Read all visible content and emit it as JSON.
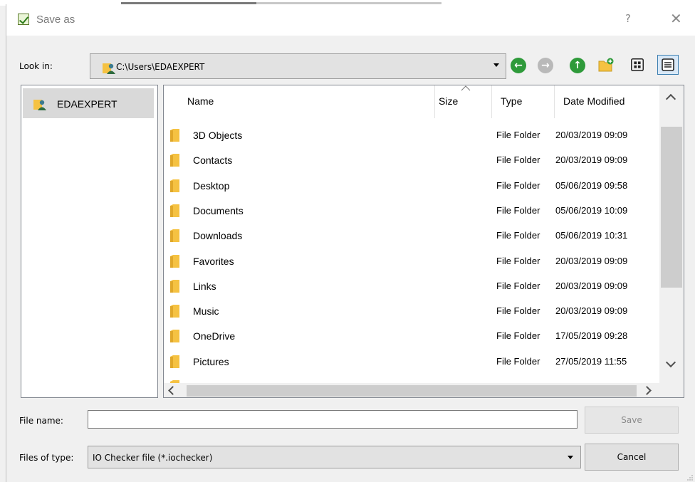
{
  "window": {
    "title": "Save as",
    "help_glyph": "?",
    "close_glyph": "✕"
  },
  "look_in": {
    "label": "Look in:",
    "path": "C:\\Users\\EDAEXPERT"
  },
  "toolbar": {
    "back_icon": "back-arrow-icon",
    "forward_icon": "forward-arrow-icon",
    "up_icon": "up-arrow-icon",
    "new_folder_icon": "new-folder-icon",
    "list_view_icon": "list-view-icon",
    "detail_view_icon": "detail-view-icon"
  },
  "sidebar": {
    "items": [
      {
        "label": "EDAEXPERT"
      }
    ]
  },
  "columns": {
    "name": "Name",
    "size": "Size",
    "type": "Type",
    "date": "Date Modified"
  },
  "files": [
    {
      "name": "3D Objects",
      "type": "File Folder",
      "date": "20/03/2019 09:09"
    },
    {
      "name": "Contacts",
      "type": "File Folder",
      "date": "20/03/2019 09:09"
    },
    {
      "name": "Desktop",
      "type": "File Folder",
      "date": "05/06/2019 09:58"
    },
    {
      "name": "Documents",
      "type": "File Folder",
      "date": "05/06/2019 10:09"
    },
    {
      "name": "Downloads",
      "type": "File Folder",
      "date": "05/06/2019 10:31"
    },
    {
      "name": "Favorites",
      "type": "File Folder",
      "date": "20/03/2019 09:09"
    },
    {
      "name": "Links",
      "type": "File Folder",
      "date": "20/03/2019 09:09"
    },
    {
      "name": "Music",
      "type": "File Folder",
      "date": "20/03/2019 09:09"
    },
    {
      "name": "OneDrive",
      "type": "File Folder",
      "date": "17/05/2019 09:28"
    },
    {
      "name": "Pictures",
      "type": "File Folder",
      "date": "27/05/2019 11:55"
    }
  ],
  "file_name": {
    "label": "File name:",
    "value": ""
  },
  "file_type": {
    "label": "Files of type:",
    "value": "IO Checker file (*.iochecker)"
  },
  "buttons": {
    "save": "Save",
    "cancel": "Cancel"
  },
  "colors": {
    "accent": "#3c7fb1",
    "nav_green": "#2e9a3a",
    "folder": "#f5c242"
  }
}
